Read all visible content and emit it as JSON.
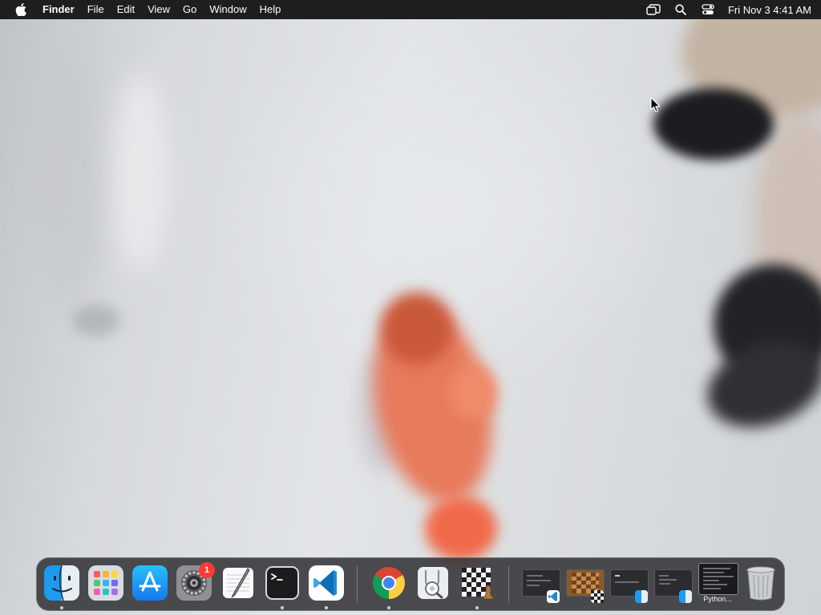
{
  "menubar": {
    "app_name": "Finder",
    "menus": [
      "File",
      "Edit",
      "View",
      "Go",
      "Window",
      "Help"
    ],
    "status_icons": [
      "screen-mirroring-icon",
      "spotlight-search-icon",
      "control-center-icon"
    ],
    "clock": "Fri Nov 3  4:41 AM"
  },
  "dock": {
    "apps": [
      {
        "name": "Finder",
        "icon": "finder-icon",
        "running": true
      },
      {
        "name": "Launchpad",
        "icon": "launchpad-icon",
        "running": false
      },
      {
        "name": "App Store",
        "icon": "app-store-icon",
        "running": false
      },
      {
        "name": "System Settings",
        "icon": "system-settings-icon",
        "running": false,
        "badge": "1"
      },
      {
        "name": "TextEdit",
        "icon": "textedit-icon",
        "running": false
      },
      {
        "name": "Terminal",
        "icon": "terminal-icon",
        "running": true
      },
      {
        "name": "Visual Studio Code",
        "icon": "vscode-icon",
        "running": true
      },
      {
        "name": "Google Chrome",
        "icon": "chrome-icon",
        "running": true
      },
      {
        "name": "Preview",
        "icon": "preview-icon",
        "running": false
      },
      {
        "name": "Chess",
        "icon": "chess-icon",
        "running": true
      }
    ],
    "minimized_windows": [
      {
        "icon": "vscode-window-thumbnail"
      },
      {
        "icon": "chess-window-thumbnail"
      },
      {
        "icon": "finder-window-thumbnail"
      },
      {
        "icon": "finder-window-thumbnail"
      },
      {
        "icon": "python-window-thumbnail",
        "label": "Python..."
      }
    ],
    "trash": {
      "icon": "trash-icon"
    }
  },
  "colors": {
    "menubar_bg": "#1e1e20",
    "badge": "#ff3b30",
    "vscode_blue": "#1f8ad2"
  }
}
